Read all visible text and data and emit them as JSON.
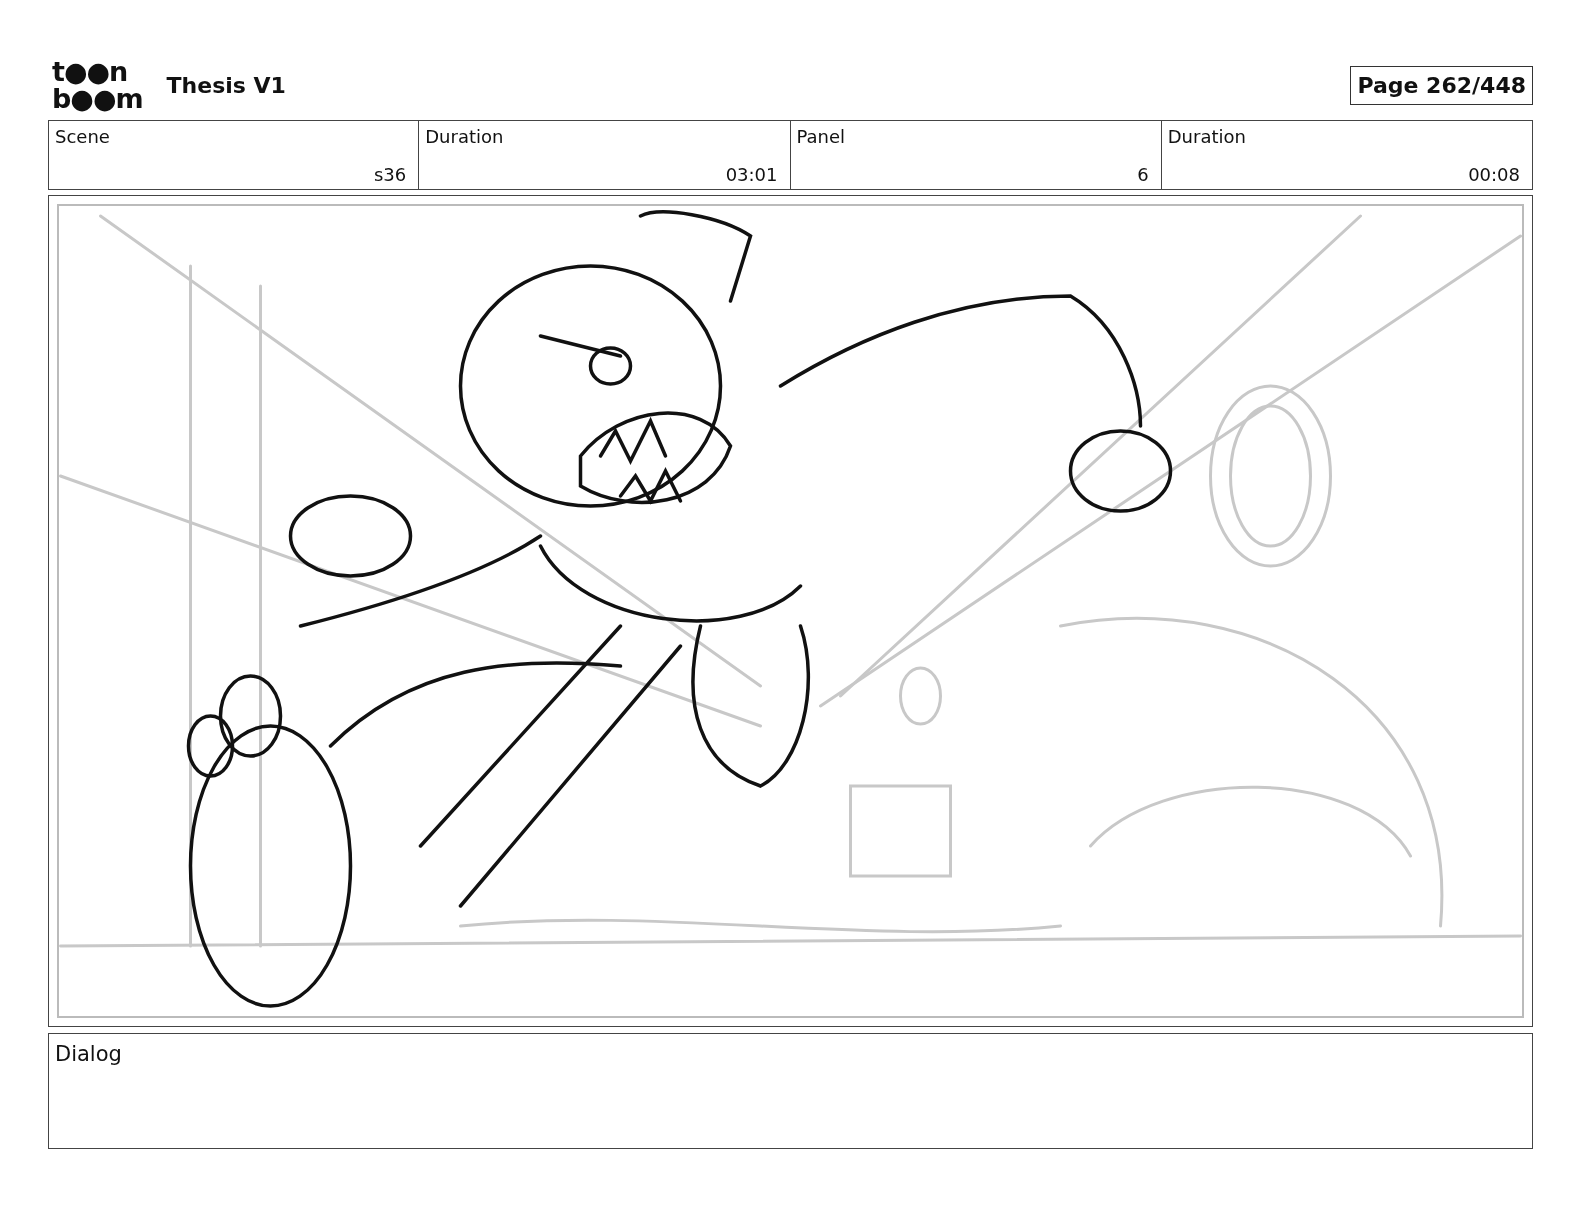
{
  "header": {
    "logo": {
      "line_1": "t●●n",
      "line_2": "b●●m"
    },
    "title": "Thesis V1",
    "page": "Page 262/448"
  },
  "info": [
    {
      "label": "Scene",
      "value": "s36"
    },
    {
      "label": "Duration",
      "value": "03:01"
    },
    {
      "label": "Panel",
      "value": "6"
    },
    {
      "label": "Duration",
      "value": "00:08"
    }
  ],
  "dialog": {
    "label": "Dialog"
  }
}
